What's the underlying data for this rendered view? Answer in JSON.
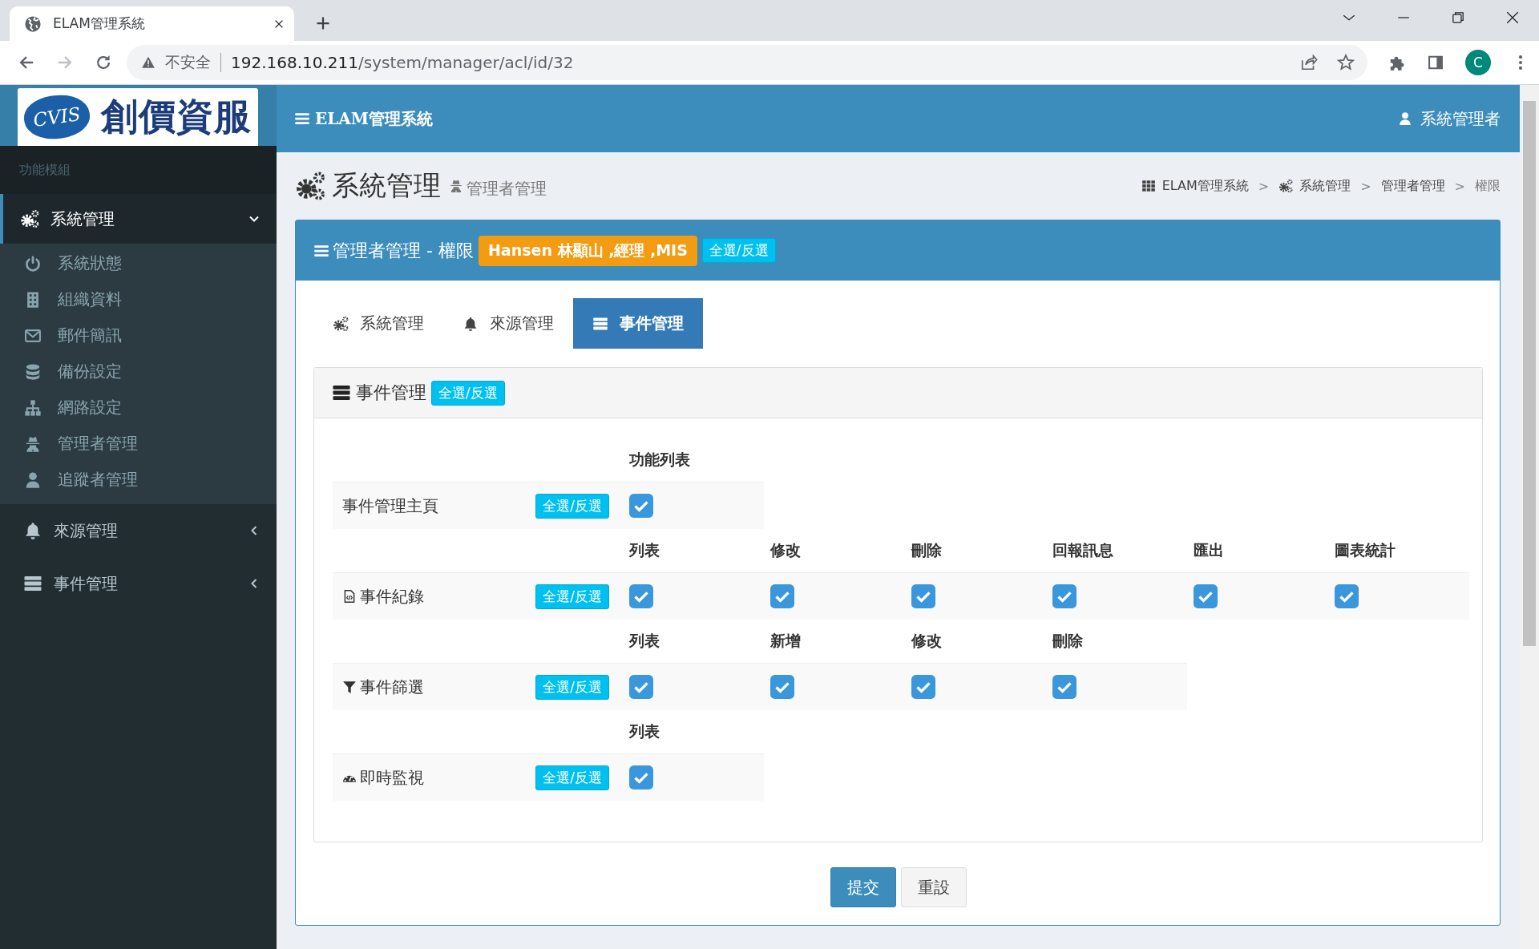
{
  "browser": {
    "tab_title": "ELAM管理系統",
    "address": {
      "security": "不安全",
      "host": "192.168.10.211",
      "path": "/system/manager/acl/id/32"
    },
    "profile_initial": "C"
  },
  "logo": {
    "mark": "CVIS",
    "name": "創價資服"
  },
  "header": {
    "brand": "ELAM管理系統",
    "user": "系統管理者"
  },
  "sidebar": {
    "section": "功能模組",
    "items": [
      {
        "label": "系統管理",
        "selected": true,
        "expanded": true,
        "children": [
          {
            "label": "系統狀態"
          },
          {
            "label": "組織資料"
          },
          {
            "label": "郵件簡訊"
          },
          {
            "label": "備份設定"
          },
          {
            "label": "網路設定"
          },
          {
            "label": "管理者管理"
          },
          {
            "label": "追蹤者管理"
          }
        ]
      },
      {
        "label": "來源管理",
        "selected": false,
        "expanded": false
      },
      {
        "label": "事件管理",
        "selected": false,
        "expanded": false
      }
    ]
  },
  "page_title": {
    "title": "系統管理",
    "subtitle": "管理者管理"
  },
  "breadcrumb": [
    {
      "label": "ELAM管理系統"
    },
    {
      "separator": ">",
      "label": "系統管理"
    },
    {
      "separator": ">",
      "label": "管理者管理"
    },
    {
      "separator": ">",
      "label": "權限"
    }
  ],
  "box": {
    "title": "管理者管理 - 權限",
    "user_badge": "Hansen 林顯山 ,經理 ,MIS",
    "toggle": "全選/反選"
  },
  "tabs": [
    {
      "label": "系統管理",
      "selected": false
    },
    {
      "label": "來源管理",
      "selected": false
    },
    {
      "label": "事件管理",
      "selected": true
    }
  ],
  "panel": {
    "title": "事件管理",
    "toggle": "全選/反選",
    "groups": [
      {
        "title": "事件管理主頁",
        "toggle": "全選/反選",
        "checks": [
          {
            "label": "功能列表",
            "checked": true
          }
        ]
      },
      {
        "title": "事件紀錄",
        "toggle": "全選/反選",
        "checks": [
          {
            "label": "列表",
            "checked": true
          },
          {
            "label": "修改",
            "checked": true
          },
          {
            "label": "刪除",
            "checked": true
          },
          {
            "label": "回報訊息",
            "checked": true
          },
          {
            "label": "匯出",
            "checked": true
          },
          {
            "label": "圖表統計",
            "checked": true
          }
        ]
      },
      {
        "title": "事件篩選",
        "toggle": "全選/反選",
        "checks": [
          {
            "label": "列表",
            "checked": true
          },
          {
            "label": "新增",
            "checked": true
          },
          {
            "label": "修改",
            "checked": true
          },
          {
            "label": "刪除",
            "checked": true
          }
        ]
      },
      {
        "title": "即時監視",
        "toggle": "全選/反選",
        "checks": [
          {
            "label": "列表",
            "checked": true
          }
        ]
      }
    ]
  },
  "buttons": [
    {
      "label": "提交",
      "kind": "primary"
    },
    {
      "label": "重設",
      "kind": "default"
    }
  ]
}
